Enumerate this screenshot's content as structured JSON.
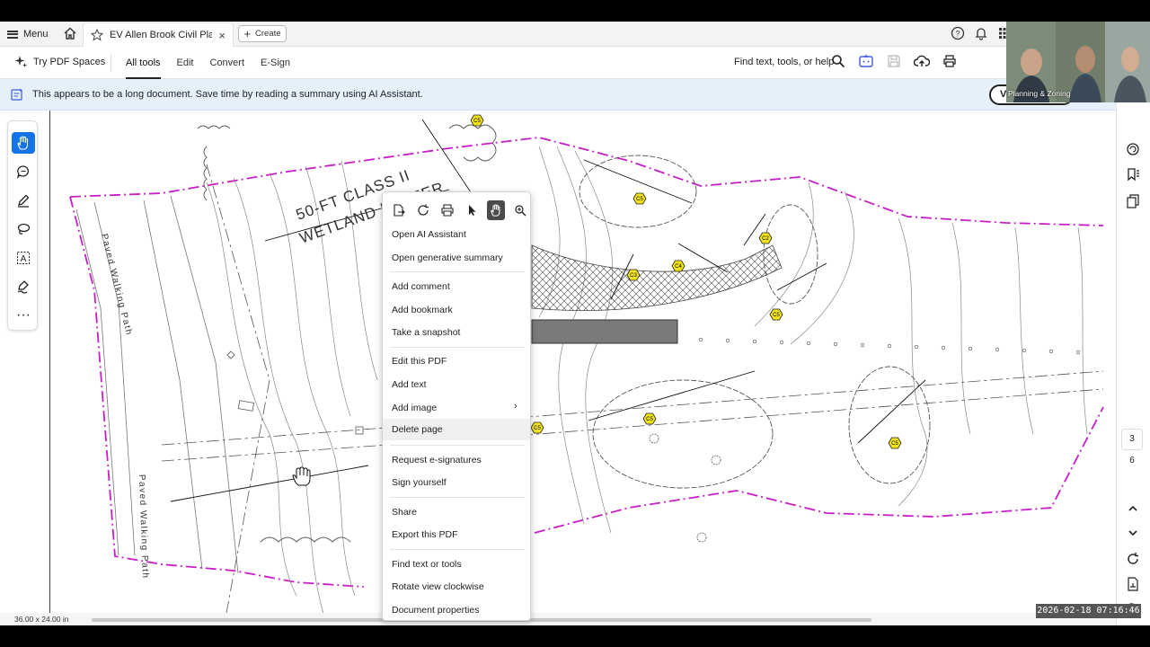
{
  "tabbar": {
    "menu_label": "Menu",
    "doc_tab_title": "EV Allen Brook Civil Pla...",
    "create_label": "Create"
  },
  "toolbar": {
    "spaces_label": "Try PDF Spaces",
    "tabs": [
      "All tools",
      "Edit",
      "Convert",
      "E-Sign"
    ],
    "find_label": "Find text, tools, or help"
  },
  "banner": {
    "text": "This appears to be a long document. Save time by reading a summary using AI Assistant.",
    "button_label": "V"
  },
  "drawing": {
    "label_buffer_1": "50-FT CLASS II",
    "label_buffer_2": "WETLAND BUFFER",
    "label_path_1": "Paved Walking Path",
    "label_path_2": "Paved Walking Path",
    "markers": [
      "C5",
      "C5",
      "C2",
      "C3",
      "C4",
      "C5",
      "C5",
      "C5",
      "C5"
    ]
  },
  "context_menu": {
    "items": [
      "Open AI Assistant",
      "Open generative summary",
      "Add comment",
      "Add bookmark",
      "Take a snapshot",
      "Edit this PDF",
      "Add text",
      "Add image",
      "Delete page",
      "Request e-signatures",
      "Sign yourself",
      "Share",
      "Export this PDF",
      "Find text or tools",
      "Rotate view clockwise",
      "Document properties"
    ]
  },
  "page_nav": {
    "current": "3",
    "total": "6"
  },
  "status": {
    "dimensions": "36.00 x 24.00 in"
  },
  "video": {
    "label": "Planning & Zoning"
  },
  "timestamp": "2026-02-18  07:16:46",
  "colors": {
    "accent": "#1473e6",
    "boundary": "#c81ec8",
    "marker": "#f2e21a"
  }
}
